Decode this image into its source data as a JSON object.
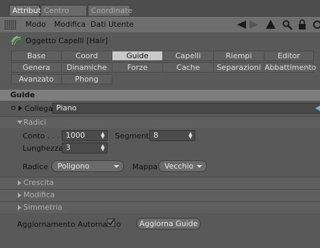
{
  "tabs": [
    "Attributi",
    "Centro Asse",
    "Coordinate"
  ],
  "menu": [
    "Modo",
    "Modifica",
    "Dati Utente"
  ],
  "object_title": "Oggetto Capelli [Hair]",
  "subtabs": {
    "row1": [
      "Base",
      "Coord",
      "Guide",
      "Capelli",
      "Riempi Capelli",
      "Editor"
    ],
    "row2": [
      "Genera",
      "Dinamiche",
      "Forze",
      "Cache",
      "Separazioni",
      "Abbattimento"
    ],
    "row3": [
      "Avanzato",
      "Phong"
    ],
    "active": "Guide"
  },
  "section_title": "Guide",
  "collega": {
    "label": "Collega",
    "value": "Piano"
  },
  "radici": {
    "header": "Radici",
    "conto_label": "Conto . . . .",
    "conto_value": "1000",
    "segmenti_label": "Segmenti",
    "segmenti_value": "8",
    "lunghezza_label": "Lunghezza",
    "lunghezza_value": "3",
    "radice_label": "Radice",
    "radice_value": "Poligono",
    "mappa_label": "Mappa",
    "mappa_value": "Vecchio"
  },
  "collapsed_groups": [
    "Crescita",
    "Modifica",
    "Simmetria"
  ],
  "auto_update": {
    "label": "Aggiornamento Automatico",
    "checked": true
  },
  "update_button": "Aggiorna Guide",
  "colors": {
    "background": "#595959",
    "active_tab": "#c9c9c9",
    "section_header": "#7e7e7e"
  }
}
